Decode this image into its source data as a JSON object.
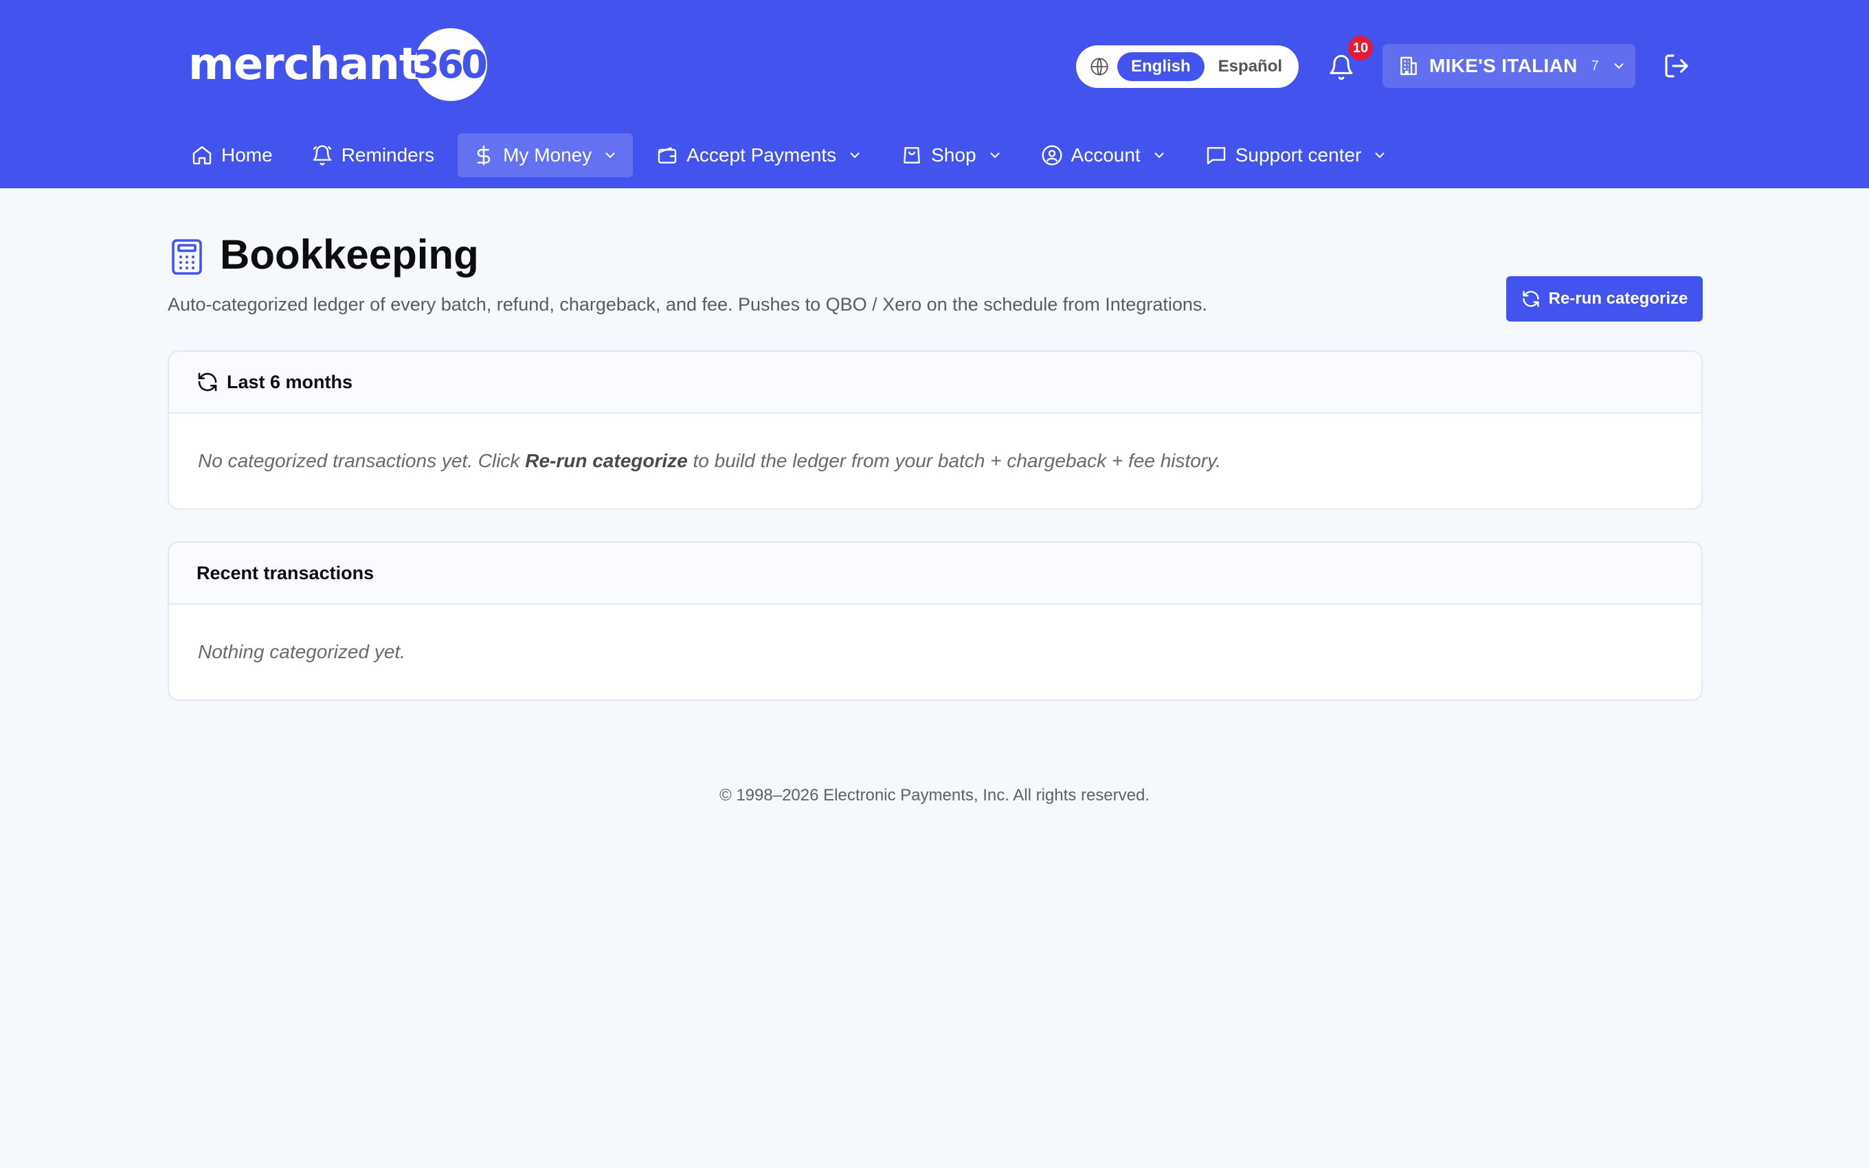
{
  "header": {
    "logo_word": "merchant",
    "logo_number": "360",
    "languages": [
      {
        "label": "English",
        "active": true
      },
      {
        "label": "Español",
        "active": false
      }
    ],
    "notification_count": "10",
    "merchant_name": "MIKE'S ITALIAN",
    "merchant_count": "7"
  },
  "nav": [
    {
      "label": "Home",
      "icon": "home-icon",
      "dropdown": false,
      "active": false
    },
    {
      "label": "Reminders",
      "icon": "bell-icon",
      "dropdown": false,
      "active": false
    },
    {
      "label": "My Money",
      "icon": "dollar-icon",
      "dropdown": true,
      "active": true
    },
    {
      "label": "Accept Payments",
      "icon": "wallet-icon",
      "dropdown": true,
      "active": false
    },
    {
      "label": "Shop",
      "icon": "shopping-bag-icon",
      "dropdown": true,
      "active": false
    },
    {
      "label": "Account",
      "icon": "user-circle-icon",
      "dropdown": true,
      "active": false
    },
    {
      "label": "Support center",
      "icon": "chat-icon",
      "dropdown": true,
      "active": false
    }
  ],
  "page": {
    "title": "Bookkeeping",
    "subtitle": "Auto-categorized ledger of every batch, refund, chargeback, and fee. Pushes to QBO / Xero on the schedule from Integrations.",
    "rerun_label": "Re-run categorize"
  },
  "summary_card": {
    "title": "Last 6 months",
    "empty_before": "No categorized transactions yet. Click ",
    "empty_link": "Re-run categorize",
    "empty_after": " to build the ledger from your batch + chargeback + fee history."
  },
  "recent_card": {
    "title": "Recent transactions",
    "empty": "Nothing categorized yet."
  },
  "footer": {
    "copyright": "© 1998–2026 Electronic Payments, Inc. All rights reserved."
  },
  "colors": {
    "brand": "#4353ee",
    "badge": "#e21a36",
    "background": "#f5f8fd"
  }
}
